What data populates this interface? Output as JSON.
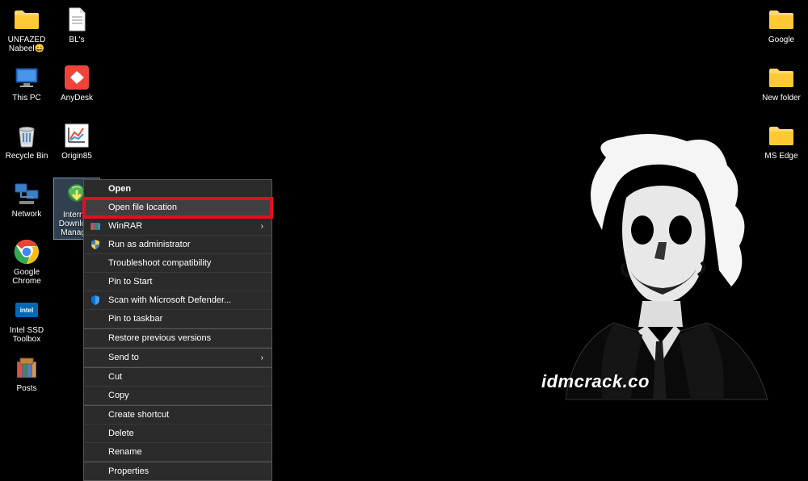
{
  "desktop_icons": {
    "left_col1": [
      {
        "label": "UNFAZED Nabeel😄",
        "type": "folder"
      },
      {
        "label": "This PC",
        "type": "thispc"
      },
      {
        "label": "Recycle Bin",
        "type": "recyclebin"
      },
      {
        "label": "Network",
        "type": "network"
      },
      {
        "label": "Google Chrome",
        "type": "chrome"
      },
      {
        "label": "Intel SSD Toolbox",
        "type": "intelssd"
      },
      {
        "label": "Posts",
        "type": "winrar"
      }
    ],
    "left_col2": [
      {
        "label": "BL's",
        "type": "textfile"
      },
      {
        "label": "AnyDesk",
        "type": "anydesk"
      },
      {
        "label": "Origin85",
        "type": "origin"
      },
      {
        "label": "Internet Download Manager",
        "type": "idm",
        "selected": true
      }
    ],
    "right_col": [
      {
        "label": "Google",
        "type": "folder"
      },
      {
        "label": "New folder",
        "type": "folder"
      },
      {
        "label": "MS Edge",
        "type": "folder"
      }
    ]
  },
  "context_menu": {
    "items": [
      {
        "label": "Open",
        "bold": true
      },
      {
        "label": "Open file location",
        "highlighted": true
      },
      {
        "label": "WinRAR",
        "icon": "winrar",
        "submenu": true
      },
      {
        "label": "Run as administrator",
        "icon": "shield"
      },
      {
        "label": "Troubleshoot compatibility"
      },
      {
        "label": "Pin to Start"
      },
      {
        "label": "Scan with Microsoft Defender...",
        "icon": "defender"
      },
      {
        "label": "Pin to taskbar"
      },
      {
        "separator": true
      },
      {
        "label": "Restore previous versions"
      },
      {
        "separator": true
      },
      {
        "label": "Send to",
        "submenu": true
      },
      {
        "separator": true
      },
      {
        "label": "Cut"
      },
      {
        "label": "Copy"
      },
      {
        "separator": true
      },
      {
        "label": "Create shortcut"
      },
      {
        "label": "Delete"
      },
      {
        "label": "Rename"
      },
      {
        "separator": true
      },
      {
        "label": "Properties"
      }
    ]
  },
  "watermark": "idmcrack.co"
}
